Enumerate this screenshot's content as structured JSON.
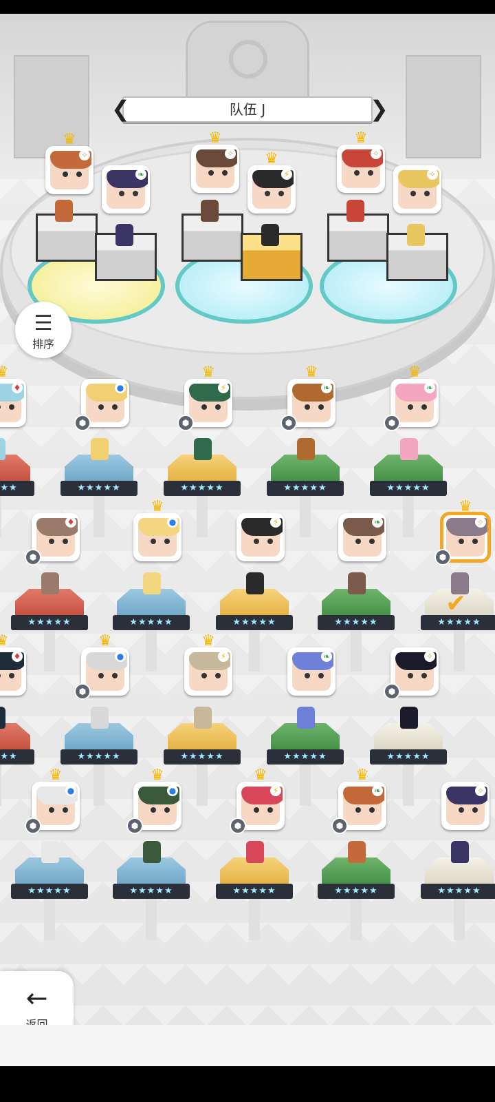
{
  "team": {
    "title": "队伍 J",
    "prev_icon": "chevron-left-icon",
    "next_icon": "chevron-right-icon"
  },
  "sort_button": {
    "label": "排序",
    "icon": "sort-icon"
  },
  "back_button": {
    "label": "返回",
    "icon": "arrow-left-icon"
  },
  "icons": {
    "crown": "♛",
    "gear": "⬢",
    "check": "✔",
    "sort": "☰",
    "back": "←",
    "prev": "❮",
    "next": "❯"
  },
  "elements": {
    "blue": "●",
    "red": "♦",
    "yellow": "⚡",
    "green": "❧",
    "white": "✧"
  },
  "stars": "★★★★★",
  "colors": {
    "accent": "#f5a623",
    "ring": "#63c9c7",
    "crown": "#f5b800"
  },
  "formation_members": [
    {
      "element": "white",
      "crowned": true
    },
    {
      "element": "green",
      "crowned": false
    },
    {
      "element": "white",
      "crowned": true
    },
    {
      "element": "yellow",
      "crowned": true
    },
    {
      "element": "white",
      "crowned": true
    },
    {
      "element": "white",
      "crowned": false
    }
  ],
  "roster": [
    {
      "element": "red",
      "crowned": true,
      "gear": false
    },
    {
      "element": "blue",
      "crowned": false,
      "gear": true
    },
    {
      "element": "yellow",
      "crowned": true,
      "gear": true
    },
    {
      "element": "green",
      "crowned": true,
      "gear": true
    },
    {
      "element": "green",
      "crowned": true,
      "gear": true
    },
    {
      "element": "red",
      "crowned": false,
      "gear": true
    },
    {
      "element": "blue",
      "crowned": true,
      "gear": false
    },
    {
      "element": "yellow",
      "crowned": false,
      "gear": false
    },
    {
      "element": "green",
      "crowned": false,
      "gear": false
    },
    {
      "element": "white",
      "crowned": true,
      "gear": true,
      "selected": true
    },
    {
      "element": "red",
      "crowned": true,
      "gear": false
    },
    {
      "element": "blue",
      "crowned": true,
      "gear": true
    },
    {
      "element": "yellow",
      "crowned": true,
      "gear": false
    },
    {
      "element": "green",
      "crowned": false,
      "gear": false
    },
    {
      "element": "white",
      "crowned": false,
      "gear": true
    },
    {
      "element": "blue",
      "crowned": true,
      "gear": true
    },
    {
      "element": "blue",
      "crowned": true,
      "gear": true
    },
    {
      "element": "yellow",
      "crowned": true,
      "gear": true
    },
    {
      "element": "green",
      "crowned": true,
      "gear": true
    },
    {
      "element": "white",
      "crowned": false,
      "gear": false
    }
  ]
}
